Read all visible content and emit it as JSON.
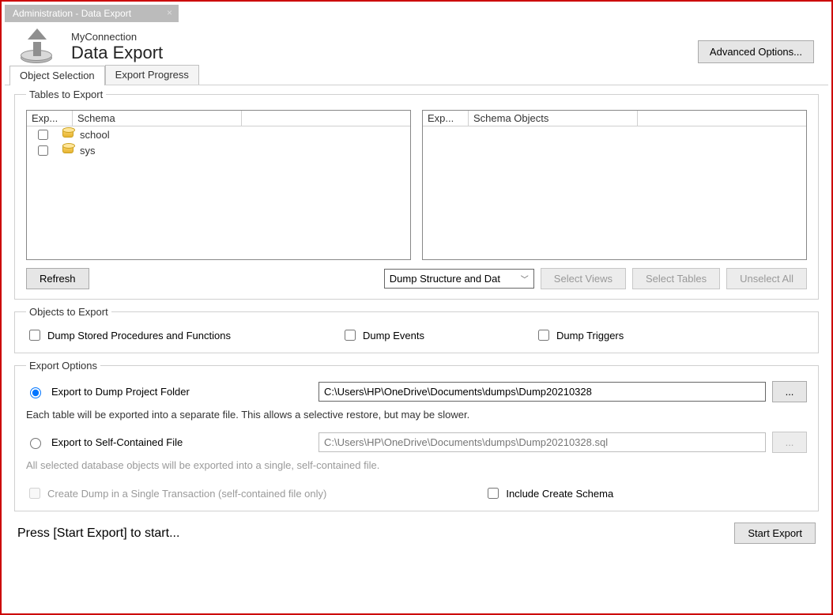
{
  "window": {
    "title": "Administration - Data Export"
  },
  "header": {
    "connection": "MyConnection",
    "page_title": "Data Export",
    "advanced_button": "Advanced Options..."
  },
  "tabs": {
    "object_selection": "Object Selection",
    "export_progress": "Export Progress"
  },
  "tables_to_export": {
    "legend": "Tables to Export",
    "left_col1": "Exp...",
    "left_col2": "Schema",
    "right_col1": "Exp...",
    "right_col2": "Schema Objects",
    "schemas": [
      {
        "name": "school"
      },
      {
        "name": "sys"
      }
    ],
    "refresh": "Refresh",
    "dump_select": "Dump Structure and Dat",
    "select_views": "Select Views",
    "select_tables": "Select Tables",
    "unselect_all": "Unselect All"
  },
  "objects_to_export": {
    "legend": "Objects to Export",
    "stored_procs": "Dump Stored Procedures and Functions",
    "events": "Dump Events",
    "triggers": "Dump Triggers"
  },
  "export_options": {
    "legend": "Export Options",
    "radio_folder": "Export to Dump Project Folder",
    "folder_path": "C:\\Users\\HP\\OneDrive\\Documents\\dumps\\Dump20210328",
    "folder_hint": "Each table will be exported into a separate file. This allows a selective restore, but may be slower.",
    "radio_self": "Export to Self-Contained File",
    "self_path": "C:\\Users\\HP\\OneDrive\\Documents\\dumps\\Dump20210328.sql",
    "self_hint": "All selected database objects will be exported into a single, self-contained file.",
    "single_tx": "Create Dump in a Single Transaction (self-contained file only)",
    "include_schema": "Include Create Schema",
    "browse": "..."
  },
  "footer": {
    "status": "Press [Start Export] to start...",
    "start": "Start Export"
  }
}
